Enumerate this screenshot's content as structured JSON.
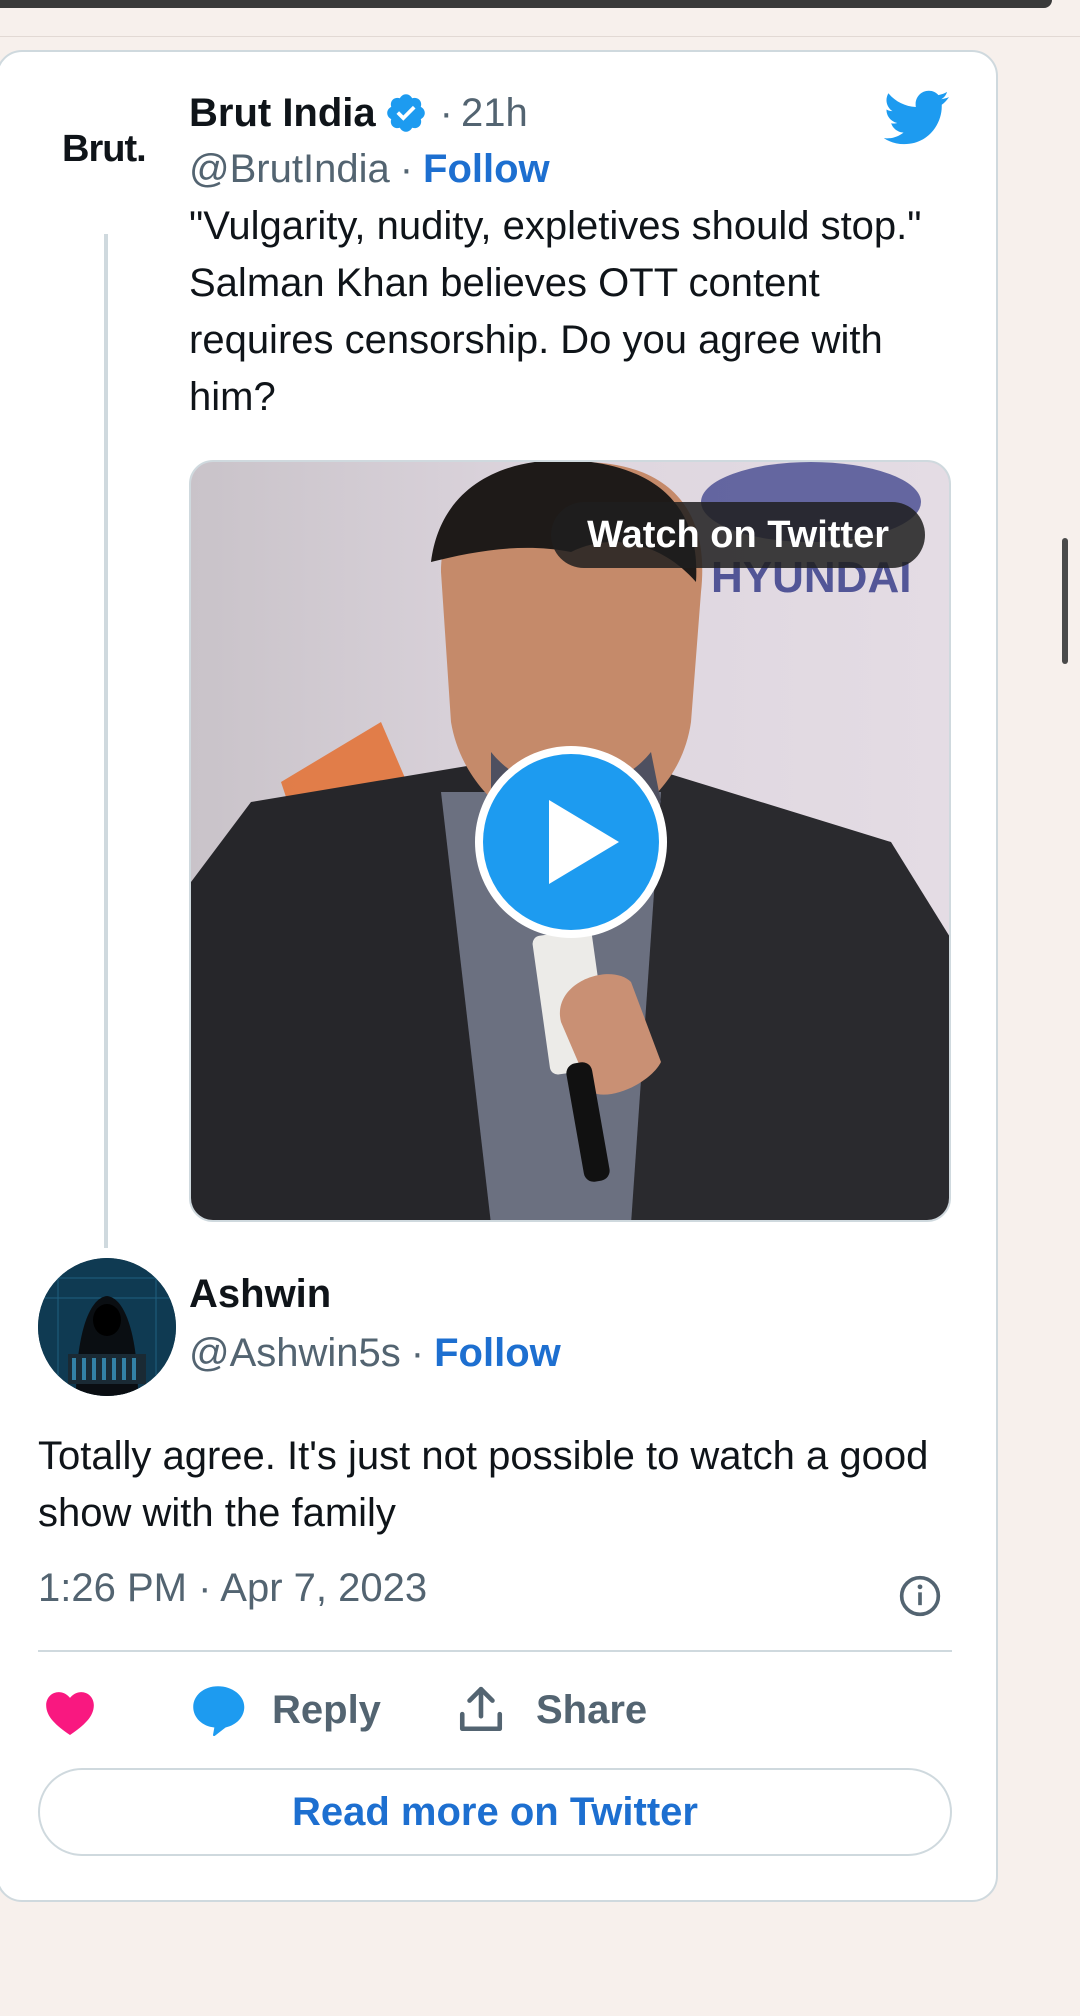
{
  "tweet": {
    "logo_text": "Brut.",
    "author_name": "Brut India",
    "separator": "·",
    "time": "21h",
    "handle": "@BrutIndia",
    "follow_label": "Follow",
    "text": "\"Vulgarity, nudity, expletives should stop.\" Salman Khan believes OTT content requires censorship. Do you agree with him?",
    "media": {
      "watch_label": "Watch on Twitter",
      "play_icon": "play-icon"
    }
  },
  "reply": {
    "author_name": "Ashwin",
    "handle": "@Ashwin5s",
    "separator": "·",
    "follow_label": "Follow",
    "text": "Totally agree. It's just not possible to watch a good show with the family",
    "timestamp": "1:26 PM · Apr 7, 2023"
  },
  "actions": {
    "like_icon": "heart-icon",
    "reply_label": "Reply",
    "share_label": "Share"
  },
  "read_more_label": "Read more on Twitter",
  "colors": {
    "accent": "#1d9bf0",
    "link": "#1d6fd0",
    "heart": "#f91880",
    "muted": "#536471",
    "text": "#0f1419",
    "border": "#cfd9de",
    "background": "#f7f0ec"
  }
}
